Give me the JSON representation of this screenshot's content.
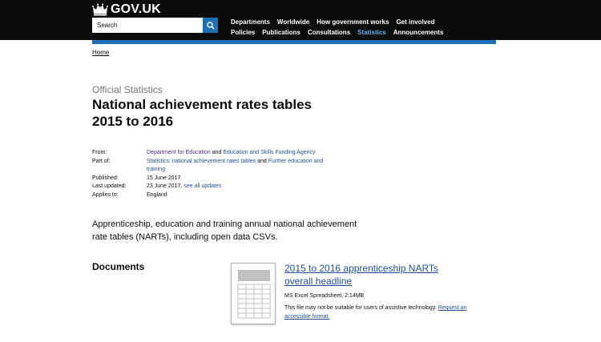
{
  "header": {
    "logo_text": "GOV.UK",
    "search_placeholder": "Search",
    "nav_row1": [
      "Departments",
      "Worldwide",
      "How government works",
      "Get involved"
    ],
    "nav_row2": [
      "Policies",
      "Publications",
      "Consultations",
      "Statistics",
      "Announcements"
    ],
    "active_nav": "Statistics",
    "colors": {
      "header_bg": "#0b0c0c",
      "accent": "#1d70b8",
      "active_link": "#5bb5f0"
    }
  },
  "breadcrumb": {
    "home": "Home"
  },
  "page": {
    "label": "Official Statistics",
    "title_line1": "National achievement rates tables",
    "title_line2": "2015 to 2016"
  },
  "metadata": {
    "from_label": "From:",
    "from_org1": "Department for Education",
    "from_and": "and",
    "from_org2": "Education and Skills Funding Agency",
    "part_of_label": "Part of:",
    "part_of_link1": "Statistics: national achievement rates tables",
    "part_of_and": "and",
    "part_of_link2_line1": "Further education and",
    "part_of_link2_line2": "training",
    "published_label": "Published:",
    "published_value": "15 June 2017",
    "updated_label": "Last updated:",
    "updated_value": "23 June 2017,",
    "updated_link": "see all updates",
    "applies_label": "Applies to:",
    "applies_value": "England"
  },
  "summary": {
    "line1": "Apprenticeship, education and training annual national achievement",
    "line2": "rate tables (NARTs), including open data CSVs."
  },
  "documents": {
    "heading": "Documents",
    "item": {
      "title_line1": "2015 to 2016 apprenticeship NARTs",
      "title_line2": "overall headline",
      "meta": "MS Excel Spreadsheet, 2.14MB",
      "note_text": "This file may not be suitable for users of assistive technology.",
      "note_link_part1": "Request an",
      "note_link_part2": "accessible format."
    }
  }
}
